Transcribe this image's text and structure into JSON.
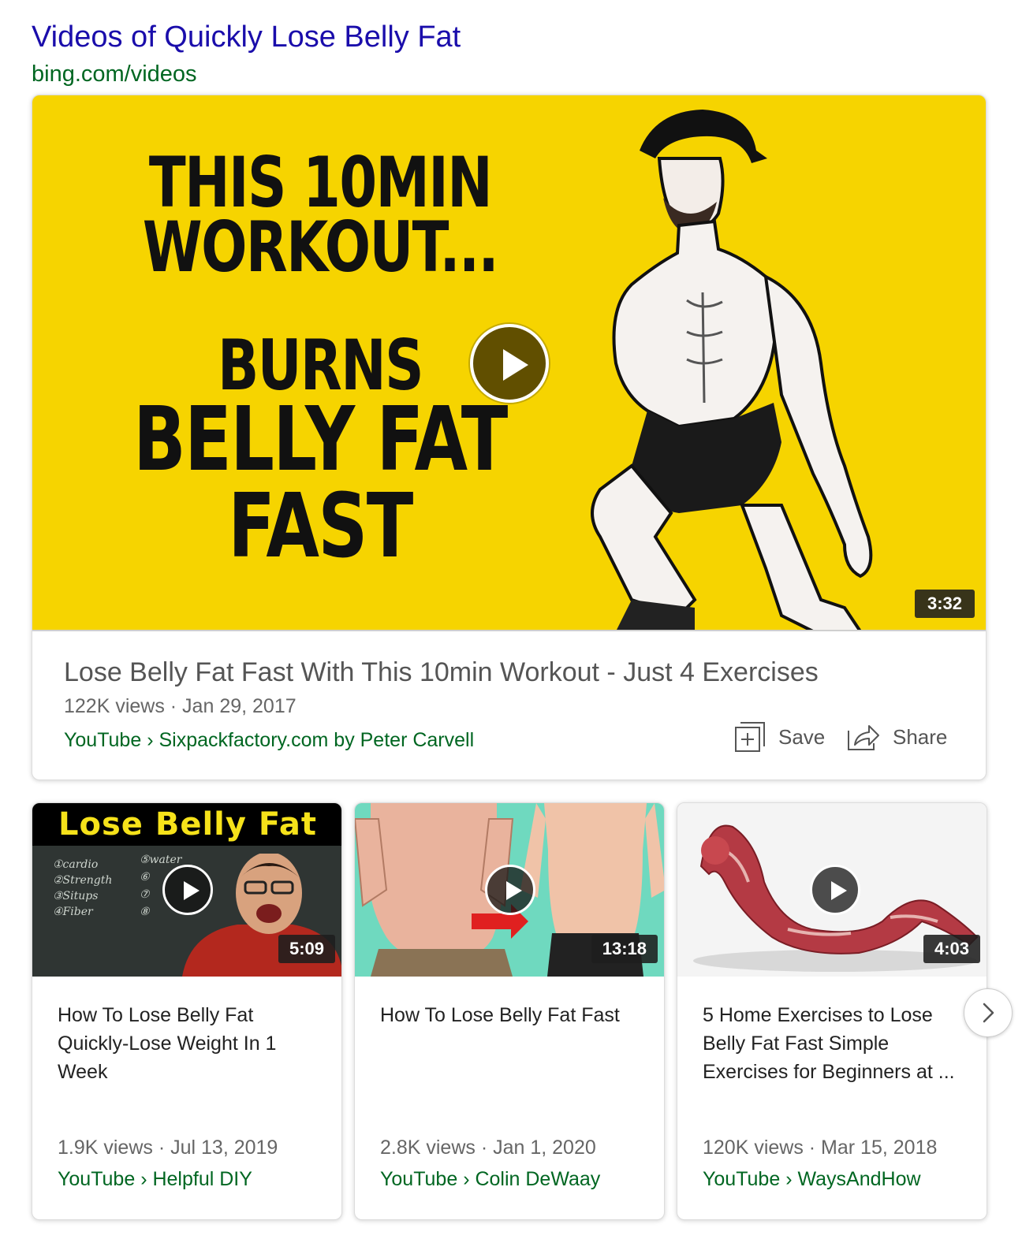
{
  "header": {
    "title": "Videos of Quickly Lose Belly Fat",
    "url": "bing.com/videos"
  },
  "featured": {
    "thumbnail_text": [
      "THIS 10MIN",
      "WORKOUT...",
      "BURNS",
      "BELLY FAT",
      "FAST"
    ],
    "duration": "3:32",
    "title": "Lose Belly Fat Fast With This 10min Workout - Just 4 Exercises",
    "meta": "122K views · Jan 29, 2017",
    "source": "YouTube › Sixpackfactory.com by Peter Carvell",
    "save_label": "Save",
    "share_label": "Share"
  },
  "cards": [
    {
      "thumbnail_banner": "Lose Belly Fat",
      "chalk": [
        "①cardio",
        "②Strength",
        "③Situps",
        "④Fiber",
        "⑤water",
        "⑥",
        "⑦",
        "⑧"
      ],
      "duration": "5:09",
      "title": "How To Lose Belly Fat Quickly-Lose Weight In 1 Week",
      "meta": "1.9K views · Jul 13, 2019",
      "source": "YouTube › Helpful DIY"
    },
    {
      "duration": "13:18",
      "title": "How To Lose Belly Fat Fast",
      "meta": "2.8K views · Jan 1, 2020",
      "source": "YouTube › Colin DeWaay"
    },
    {
      "duration": "4:03",
      "title": "5 Home Exercises to Lose Belly Fat Fast Simple Exercises for Beginners at ...",
      "meta": "120K views · Mar 15, 2018",
      "source": "YouTube › WaysAndHow"
    }
  ],
  "icons": {
    "play": "play-icon",
    "save": "save-plus-icon",
    "share": "share-icon",
    "next": "chevron-right-icon"
  },
  "colors": {
    "title_link": "#1a0dab",
    "url_green": "#006621",
    "thumb_yellow": "#f6d400"
  }
}
